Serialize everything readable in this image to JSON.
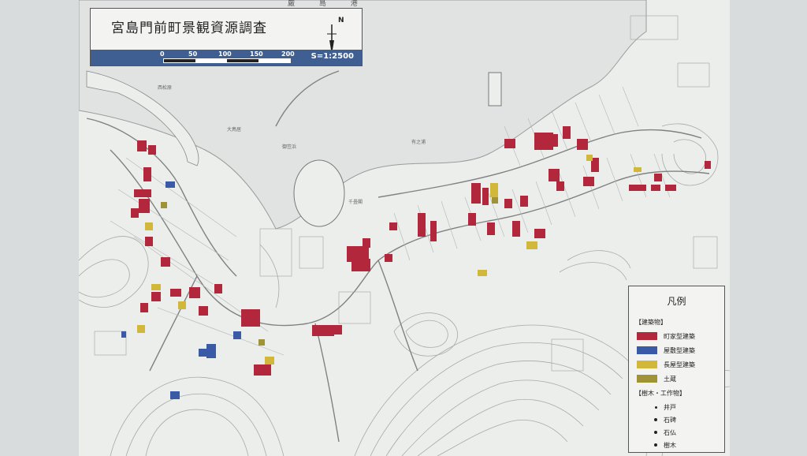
{
  "title": "宮島門前町景観資源調査",
  "north_label": "N",
  "scale": {
    "ticks": [
      "0",
      "50",
      "100",
      "150",
      "200"
    ],
    "ratio": "S=1:2500"
  },
  "top_label": "厳 島 港",
  "legend": {
    "title": "凡例",
    "buildings_heading": "【建築物】",
    "building_types": [
      {
        "label": "町家型建築",
        "color": "#b3273d"
      },
      {
        "label": "屋敷型建築",
        "color": "#3a5aa8"
      },
      {
        "label": "長屋型建築",
        "color": "#d2b83a"
      },
      {
        "label": "土蔵",
        "color": "#a09236"
      }
    ],
    "trees_heading": "【樹木・工作物】",
    "point_types": [
      {
        "label": "井戸"
      },
      {
        "label": "石碑"
      },
      {
        "label": "石仏"
      },
      {
        "label": "樹木"
      }
    ]
  },
  "map_labels": [
    "西松原",
    "大鳥居",
    "御笠浜",
    "有之浦",
    "千畳閣"
  ],
  "colors": {
    "machiya": "#b3273d",
    "yashiki": "#3a5aa8",
    "nagaya": "#d2b83a",
    "dozo": "#a09236",
    "sea": "#e1e3e3",
    "land": "#eceeec",
    "scale_strip": "#3f5f93"
  }
}
